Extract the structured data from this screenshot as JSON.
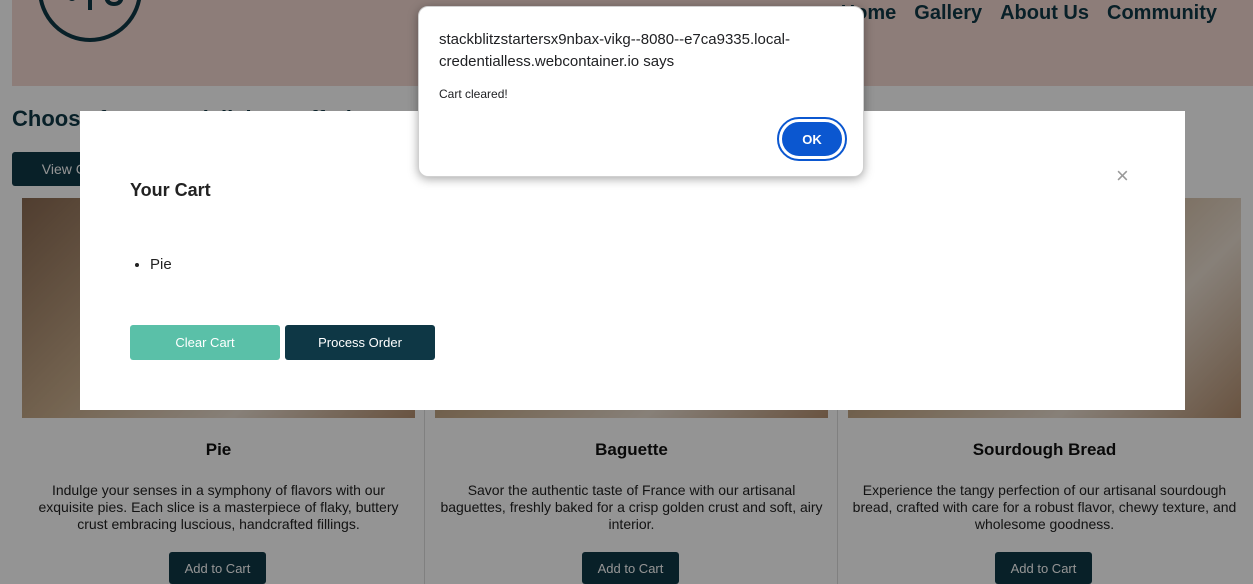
{
  "nav": {
    "items": [
      "Home",
      "Gallery",
      "About Us",
      "Community"
    ]
  },
  "section": {
    "title": "Choose from our delicious offerings",
    "view_button": "View Cart"
  },
  "products": [
    {
      "name": "Pie",
      "description": "Indulge your senses in a symphony of flavors with our exquisite pies. Each slice is a masterpiece of flaky, buttery crust embracing luscious, handcrafted fillings.",
      "button": "Add to Cart"
    },
    {
      "name": "Baguette",
      "description": "Savor the authentic taste of France with our artisanal baguettes, freshly baked for a crisp golden crust and soft, airy interior.",
      "button": "Add to Cart"
    },
    {
      "name": "Sourdough Bread",
      "description": "Experience the tangy perfection of our artisanal sourdough bread, crafted with care for a robust flavor, chewy texture, and wholesome goodness.",
      "button": "Add to Cart"
    }
  ],
  "cart": {
    "title": "Your Cart",
    "close": "×",
    "items": [
      "Pie"
    ],
    "clear_button": "Clear Cart",
    "process_button": "Process Order"
  },
  "alert": {
    "origin": "stackblitzstartersx9nbax-vikg--8080--e7ca9335.local-credentialless.webcontainer.io says",
    "message": "Cart cleared!",
    "ok_button": "OK"
  },
  "colors": {
    "header_bg": "#f3d8d0",
    "primary": "#0e3745",
    "clear_button": "#5ac0a8",
    "alert_ok": "#0b57d0"
  }
}
